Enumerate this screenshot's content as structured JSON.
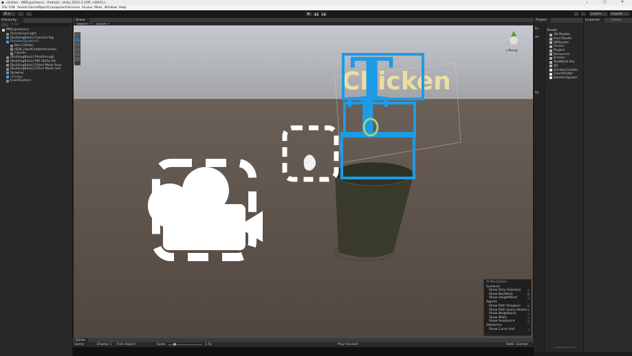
{
  "window": {
    "title": "chicken - MRExperience - Android - Unity 2022.3.10f1 <DX11>",
    "controls": [
      "–",
      "□",
      "✕"
    ]
  },
  "menu": [
    "File",
    "Edit",
    "Assets",
    "GameObject",
    "Component",
    "Services",
    "Oculus",
    "Meta",
    "Window",
    "Help"
  ],
  "toolbar": {
    "account": "JB ▾",
    "play_controls": [
      "▶",
      "❚❚",
      "▶❚"
    ],
    "layers": "Layers",
    "layout": "Layout"
  },
  "hierarchy": {
    "tab": "Hierarchy",
    "search_placeholder": "Q All",
    "items": [
      {
        "label": "MRExperience",
        "depth": 0,
        "kind": "scene"
      },
      {
        "label": "Directional Light",
        "depth": 1,
        "kind": "obj"
      },
      {
        "label": "[BuildingBlock] Camera Rig",
        "depth": 1,
        "kind": "obj"
      },
      {
        "label": "RandomSpawner1",
        "depth": 1,
        "kind": "prefab"
      },
      {
        "label": "Box Collider",
        "depth": 2,
        "kind": "obj"
      },
      {
        "label": "ISDK_HandGrabInteraction",
        "depth": 2,
        "kind": "obj"
      },
      {
        "label": "Canvas",
        "depth": 2,
        "kind": "obj"
      },
      {
        "label": "[BuildingBlock] Passthrough",
        "depth": 1,
        "kind": "obj"
      },
      {
        "label": "[BuildingBlock] MR Utility Kit",
        "depth": 1,
        "kind": "obj"
      },
      {
        "label": "[BuildingBlock] Effect Mesh floor",
        "depth": 1,
        "kind": "obj"
      },
      {
        "label": "[BuildingBlock] Effect Mesh rest",
        "depth": 1,
        "kind": "obj"
      },
      {
        "label": "Spawner",
        "depth": 1,
        "kind": "obj"
      },
      {
        "label": "Chicken",
        "depth": 1,
        "kind": "prefab"
      },
      {
        "label": "EventSystem",
        "depth": 1,
        "kind": "obj"
      }
    ]
  },
  "scene": {
    "tab": "Scene",
    "center": "Center ▾",
    "local": "Local ▾",
    "persp": "←Persp",
    "text_chicken": "Chicken",
    "letter": "T"
  },
  "navigation": {
    "title": "AI Navigation",
    "sections": [
      {
        "name": "Surfaces",
        "items": [
          {
            "label": "Show Only Selected",
            "checked": false
          },
          {
            "label": "Show NavMesh",
            "checked": true
          },
          {
            "label": "Show HeightMesh",
            "checked": false
          }
        ]
      },
      {
        "name": "Agents",
        "items": [
          {
            "label": "Show Path Polygons",
            "checked": true
          },
          {
            "label": "Show Path Query Nodes",
            "checked": false
          },
          {
            "label": "Show Neighbours",
            "checked": false
          },
          {
            "label": "Show Walls",
            "checked": false
          },
          {
            "label": "Show Avoidance",
            "checked": false
          }
        ]
      },
      {
        "name": "Obstacles",
        "items": [
          {
            "label": "Show Carve Hull",
            "checked": false
          }
        ]
      }
    ]
  },
  "game": {
    "tab": "Game",
    "game_sel": "Game",
    "display": "Display 1",
    "aspect": "Free Aspect",
    "scale_label": "Scale",
    "scale_value": "1.5x",
    "play_focused": "Play Focused",
    "stats": "Stats",
    "gizmos": "Gizmos"
  },
  "project": {
    "tab": "Project",
    "favorites": "Fa",
    "assets_root": "As",
    "assets_header": "Assets",
    "packages": "Pa",
    "items": [
      {
        "label": "3D Models",
        "kind": "folder"
      },
      {
        "label": "Hovl Studio",
        "kind": "folder"
      },
      {
        "label": "MRAssets",
        "kind": "folder"
      },
      {
        "label": "Oculus",
        "kind": "folder"
      },
      {
        "label": "Plugins",
        "kind": "folder"
      },
      {
        "label": "Resources",
        "kind": "folder"
      },
      {
        "label": "Scenes",
        "kind": "folder"
      },
      {
        "label": "TextMesh Pro",
        "kind": "folder"
      },
      {
        "label": "XR",
        "kind": "folder"
      },
      {
        "label": "ChickenCollider",
        "kind": "script"
      },
      {
        "label": "Countholder",
        "kind": "script"
      },
      {
        "label": "RandomSpawn",
        "kind": "script"
      }
    ]
  },
  "inspector": {
    "tab": "Inspector",
    "tab2": "Conso"
  },
  "colors": {
    "blue": "#1e9be6",
    "chicken_text": "#f5e7a0",
    "floor": "#5a5048",
    "sky": "#c9cdd3"
  }
}
